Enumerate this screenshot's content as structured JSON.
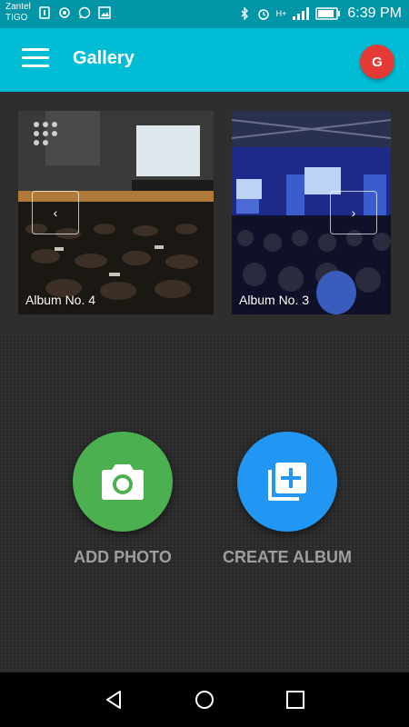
{
  "status_bar": {
    "carrier_top": "Zantel",
    "carrier_bottom": "TIGO",
    "time": "6:39 PM",
    "network_label": "H+"
  },
  "app_bar": {
    "title": "Gallery",
    "avatar_initial": "G",
    "avatar_color": "#e53935"
  },
  "albums": [
    {
      "label": "Album No. 4"
    },
    {
      "label": "Album No. 3"
    }
  ],
  "gallery_nav": {
    "prev_symbol": "‹",
    "next_symbol": "›"
  },
  "actions": {
    "add_photo": {
      "label": "ADD PHOTO",
      "color": "#4caf50",
      "icon": "camera-icon"
    },
    "create_album": {
      "label": "CREATE ALBUM",
      "color": "#2196f3",
      "icon": "add-to-photos-icon"
    }
  },
  "colors": {
    "status_bar": "#0096a8",
    "app_bar": "#00bcd4",
    "background": "#2b2b2b"
  }
}
